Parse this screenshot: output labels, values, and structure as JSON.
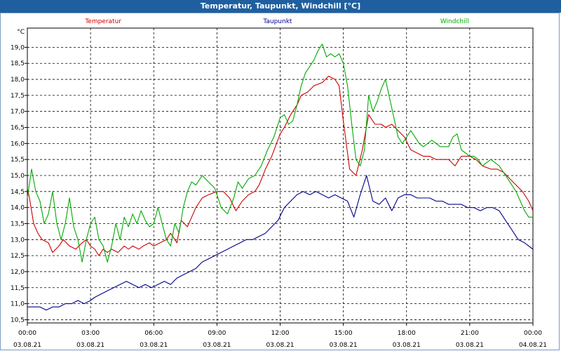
{
  "window": {
    "title": "Temperatur, Taupunkt, Windchill [°C]"
  },
  "chart_data": {
    "type": "line",
    "title": "Temperatur, Taupunkt, Windchill [°C]",
    "y_unit_label": "°C",
    "ylim": [
      10.4,
      19.6
    ],
    "y_ticks": [
      "10,5",
      "11,0",
      "11,5",
      "12,0",
      "12,5",
      "13,0",
      "13,5",
      "14,0",
      "14,5",
      "15,0",
      "15,5",
      "16,0",
      "16,5",
      "17,0",
      "17,5",
      "18,0",
      "18,5",
      "19,0"
    ],
    "x_range_hours": [
      0,
      24
    ],
    "x_ticks": [
      {
        "time": "00:00",
        "date": "03.08.21"
      },
      {
        "time": "03:00",
        "date": "03.08.21"
      },
      {
        "time": "06:00",
        "date": "03.08.21"
      },
      {
        "time": "09:00",
        "date": "03.08.21"
      },
      {
        "time": "12:00",
        "date": "03.08.21"
      },
      {
        "time": "15:00",
        "date": "03.08.21"
      },
      {
        "time": "18:00",
        "date": "03.08.21"
      },
      {
        "time": "21:00",
        "date": "03.08.21"
      },
      {
        "time": "00:00",
        "date": "04.08.21"
      }
    ],
    "grid": true,
    "legend_placement": "top",
    "series": [
      {
        "name": "Temperatur",
        "color": "#cc0000",
        "x": [
          0,
          0.1,
          0.3,
          0.5,
          0.7,
          1.0,
          1.2,
          1.5,
          1.7,
          2.0,
          2.3,
          2.6,
          2.8,
          3.0,
          3.2,
          3.4,
          3.6,
          3.8,
          4.0,
          4.3,
          4.6,
          4.8,
          5.0,
          5.3,
          5.5,
          5.8,
          6.0,
          6.3,
          6.6,
          6.8,
          7.1,
          7.3,
          7.6,
          8.0,
          8.3,
          8.6,
          9.0,
          9.3,
          9.6,
          9.9,
          10.2,
          10.5,
          10.8,
          11.0,
          11.3,
          11.6,
          12.0,
          12.2,
          12.5,
          12.8,
          13.0,
          13.3,
          13.6,
          14.0,
          14.3,
          14.6,
          14.8,
          15.0,
          15.3,
          15.6,
          15.9,
          16.2,
          16.5,
          16.8,
          17.0,
          17.3,
          17.6,
          17.9,
          18.2,
          18.5,
          18.8,
          19.1,
          19.4,
          19.7,
          20.0,
          20.3,
          20.6,
          21.0,
          21.3,
          21.6,
          22.0,
          22.3,
          22.6,
          22.9,
          23.2,
          23.5,
          23.8,
          24.0
        ],
        "values": [
          14.6,
          14.3,
          13.5,
          13.2,
          13.0,
          12.9,
          12.6,
          12.8,
          13.0,
          12.8,
          12.7,
          12.9,
          13.0,
          12.8,
          12.7,
          12.5,
          12.7,
          12.6,
          12.7,
          12.6,
          12.8,
          12.7,
          12.8,
          12.7,
          12.8,
          12.9,
          12.8,
          12.9,
          13.0,
          13.2,
          12.9,
          13.6,
          13.4,
          14.0,
          14.3,
          14.4,
          14.5,
          14.5,
          14.3,
          13.9,
          14.2,
          14.4,
          14.5,
          14.7,
          15.2,
          15.6,
          16.3,
          16.5,
          16.9,
          17.2,
          17.5,
          17.6,
          17.8,
          17.9,
          18.1,
          18.0,
          17.8,
          16.7,
          15.2,
          15.0,
          15.8,
          16.9,
          16.6,
          16.6,
          16.5,
          16.6,
          16.4,
          16.2,
          15.8,
          15.7,
          15.6,
          15.6,
          15.5,
          15.5,
          15.5,
          15.3,
          15.6,
          15.6,
          15.5,
          15.3,
          15.2,
          15.2,
          15.1,
          14.9,
          14.7,
          14.5,
          14.2,
          13.9
        ]
      },
      {
        "name": "Taupunkt",
        "color": "#00008b",
        "x": [
          0,
          0.3,
          0.6,
          0.9,
          1.2,
          1.5,
          1.8,
          2.1,
          2.4,
          2.7,
          3.0,
          3.2,
          3.5,
          3.8,
          4.1,
          4.4,
          4.7,
          5.0,
          5.3,
          5.6,
          5.9,
          6.2,
          6.5,
          6.8,
          7.1,
          7.4,
          7.7,
          8.0,
          8.3,
          8.6,
          8.9,
          9.2,
          9.5,
          9.8,
          10.1,
          10.4,
          10.7,
          11.0,
          11.3,
          11.6,
          11.9,
          12.2,
          12.5,
          12.8,
          13.1,
          13.4,
          13.7,
          14.0,
          14.3,
          14.6,
          14.9,
          15.2,
          15.5,
          15.8,
          16.1,
          16.4,
          16.7,
          17.0,
          17.3,
          17.6,
          17.9,
          18.2,
          18.5,
          18.8,
          19.1,
          19.4,
          19.7,
          20.0,
          20.3,
          20.6,
          20.9,
          21.2,
          21.5,
          21.8,
          22.1,
          22.4,
          22.7,
          23.0,
          23.3,
          23.6,
          24.0
        ],
        "values": [
          10.9,
          10.9,
          10.9,
          10.8,
          10.9,
          10.9,
          11.0,
          11.0,
          11.1,
          11.0,
          11.1,
          11.2,
          11.3,
          11.4,
          11.5,
          11.6,
          11.7,
          11.6,
          11.5,
          11.6,
          11.5,
          11.6,
          11.7,
          11.6,
          11.8,
          11.9,
          12.0,
          12.1,
          12.3,
          12.4,
          12.5,
          12.6,
          12.7,
          12.8,
          12.9,
          13.0,
          13.0,
          13.1,
          13.2,
          13.4,
          13.6,
          14.0,
          14.2,
          14.4,
          14.5,
          14.4,
          14.5,
          14.4,
          14.3,
          14.4,
          14.3,
          14.2,
          13.7,
          14.4,
          15.0,
          14.2,
          14.1,
          14.3,
          13.9,
          14.3,
          14.4,
          14.4,
          14.3,
          14.3,
          14.3,
          14.2,
          14.2,
          14.1,
          14.1,
          14.1,
          14.0,
          14.0,
          13.9,
          14.0,
          14.0,
          13.9,
          13.6,
          13.3,
          13.0,
          12.9,
          12.7
        ]
      },
      {
        "name": "Windchill",
        "color": "#00aa00",
        "x": [
          0,
          0.2,
          0.4,
          0.6,
          0.8,
          1.0,
          1.2,
          1.4,
          1.6,
          1.8,
          2.0,
          2.2,
          2.4,
          2.6,
          2.8,
          3.0,
          3.2,
          3.4,
          3.6,
          3.8,
          4.0,
          4.2,
          4.4,
          4.6,
          4.8,
          5.0,
          5.2,
          5.4,
          5.6,
          5.8,
          6.0,
          6.2,
          6.4,
          6.6,
          6.8,
          7.0,
          7.2,
          7.4,
          7.6,
          7.8,
          8.0,
          8.3,
          8.6,
          8.9,
          9.2,
          9.5,
          9.8,
          10.0,
          10.2,
          10.5,
          10.8,
          11.1,
          11.4,
          11.7,
          12.0,
          12.2,
          12.4,
          12.6,
          12.8,
          13.0,
          13.2,
          13.4,
          13.6,
          13.8,
          14.0,
          14.2,
          14.4,
          14.6,
          14.8,
          15.0,
          15.2,
          15.4,
          15.6,
          15.8,
          16.0,
          16.2,
          16.4,
          16.6,
          16.8,
          17.0,
          17.2,
          17.4,
          17.6,
          17.8,
          18.0,
          18.2,
          18.4,
          18.6,
          18.8,
          19.0,
          19.2,
          19.4,
          19.6,
          19.8,
          20.0,
          20.2,
          20.4,
          20.6,
          20.8,
          21.0,
          21.2,
          21.4,
          21.6,
          21.8,
          22.0,
          22.2,
          22.4,
          22.6,
          22.8,
          23.0,
          23.2,
          23.4,
          23.6,
          23.8,
          24.0
        ],
        "values": [
          14.3,
          15.2,
          14.5,
          14.2,
          13.5,
          13.8,
          14.5,
          13.5,
          13.0,
          13.5,
          14.3,
          13.4,
          13.0,
          12.3,
          13.0,
          13.5,
          13.7,
          13.0,
          12.8,
          12.3,
          12.8,
          13.5,
          13.0,
          13.7,
          13.4,
          13.8,
          13.5,
          13.9,
          13.6,
          13.4,
          13.5,
          14.0,
          13.5,
          13.0,
          12.8,
          13.5,
          13.2,
          14.0,
          14.5,
          14.8,
          14.7,
          15.0,
          14.8,
          14.6,
          14.0,
          13.8,
          14.3,
          14.8,
          14.6,
          14.9,
          15.0,
          15.3,
          15.8,
          16.2,
          16.8,
          16.9,
          16.6,
          16.7,
          17.2,
          17.8,
          18.2,
          18.4,
          18.6,
          18.9,
          19.1,
          18.7,
          18.8,
          18.7,
          18.8,
          18.5,
          17.8,
          16.6,
          15.5,
          15.3,
          15.8,
          17.5,
          17.0,
          17.3,
          17.7,
          18.0,
          17.4,
          16.8,
          16.2,
          16.0,
          16.2,
          16.4,
          16.2,
          16.0,
          15.9,
          16.0,
          16.1,
          16.0,
          15.9,
          15.9,
          15.9,
          16.2,
          16.3,
          15.8,
          15.7,
          15.6,
          15.6,
          15.5,
          15.3,
          15.4,
          15.5,
          15.4,
          15.3,
          15.1,
          14.9,
          14.7,
          14.5,
          14.2,
          13.9,
          13.7,
          13.7
        ]
      }
    ]
  }
}
